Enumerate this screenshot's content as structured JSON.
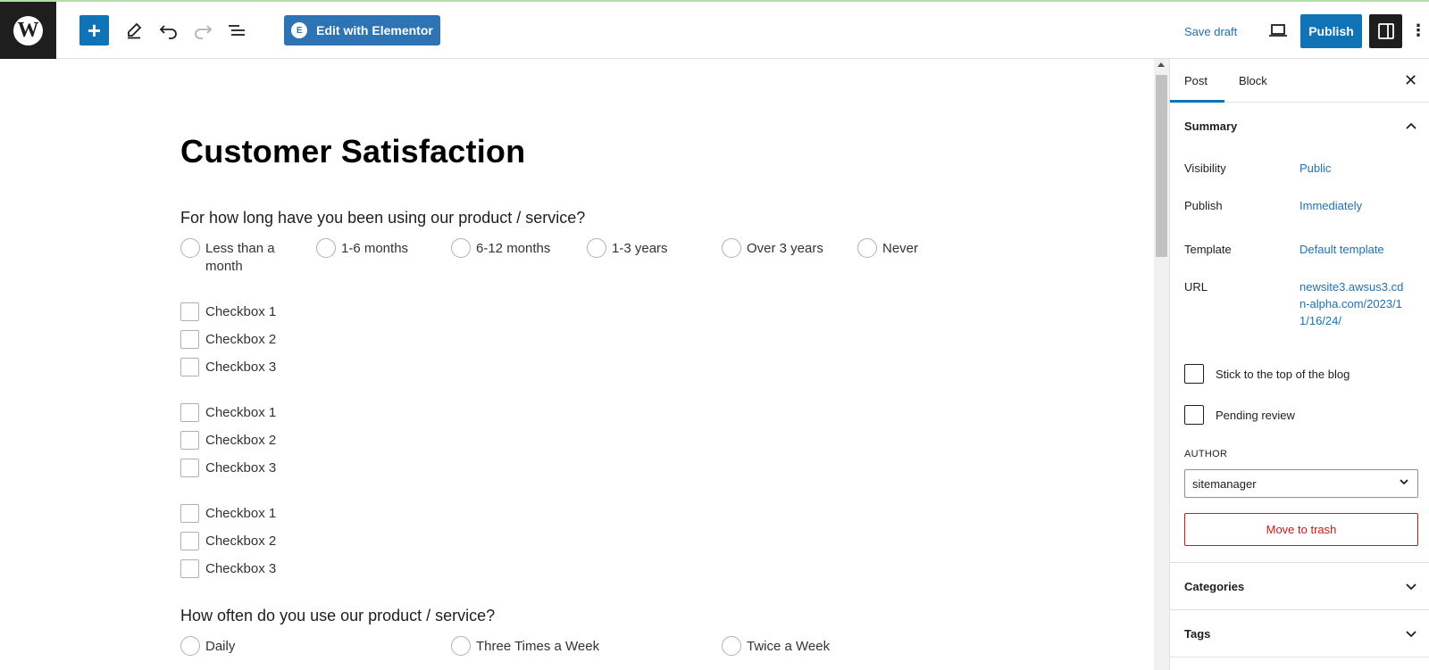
{
  "toolbar": {
    "logo_glyph": "W",
    "add_symbol": "+",
    "elementor_label": "Edit with Elementor",
    "elementor_badge": "E",
    "save_draft": "Save draft",
    "publish": "Publish",
    "more_symbol": "⋮"
  },
  "post": {
    "title": "Customer Satisfaction",
    "question1": "For how long have you been using our product / service?",
    "question1_options": [
      "Less than a month",
      "1-6 months",
      "6-12 months",
      "1-3 years",
      "Over 3 years",
      "Never"
    ],
    "checkbox_groups": [
      [
        "Checkbox 1",
        "Checkbox 2",
        "Checkbox 3"
      ],
      [
        "Checkbox 1",
        "Checkbox 2",
        "Checkbox 3"
      ],
      [
        "Checkbox 1",
        "Checkbox 2",
        "Checkbox 3"
      ]
    ],
    "question2": "How often do you use our product / service?",
    "question2_options": [
      "Daily",
      "Three Times a Week",
      "Twice a Week"
    ]
  },
  "sidebar": {
    "tab_post": "Post",
    "tab_block": "Block",
    "close_symbol": "✕",
    "summary_title": "Summary",
    "visibility_label": "Visibility",
    "visibility_value": "Public",
    "publish_label": "Publish",
    "publish_value": "Immediately",
    "template_label": "Template",
    "template_value": "Default template",
    "url_label": "URL",
    "url_value": "newsite3.awsus3.cdn-alpha.com/2023/11/16/24/",
    "stick_top": "Stick to the top of the blog",
    "pending_review": "Pending review",
    "author_label": "AUTHOR",
    "author_value": "sitemanager",
    "move_to_trash": "Move to trash",
    "categories_title": "Categories",
    "tags_title": "Tags"
  },
  "colors": {
    "accent": "#0f73b5",
    "link": "#2271b1",
    "danger": "#cc1818",
    "elementor": "#2e74b5"
  }
}
